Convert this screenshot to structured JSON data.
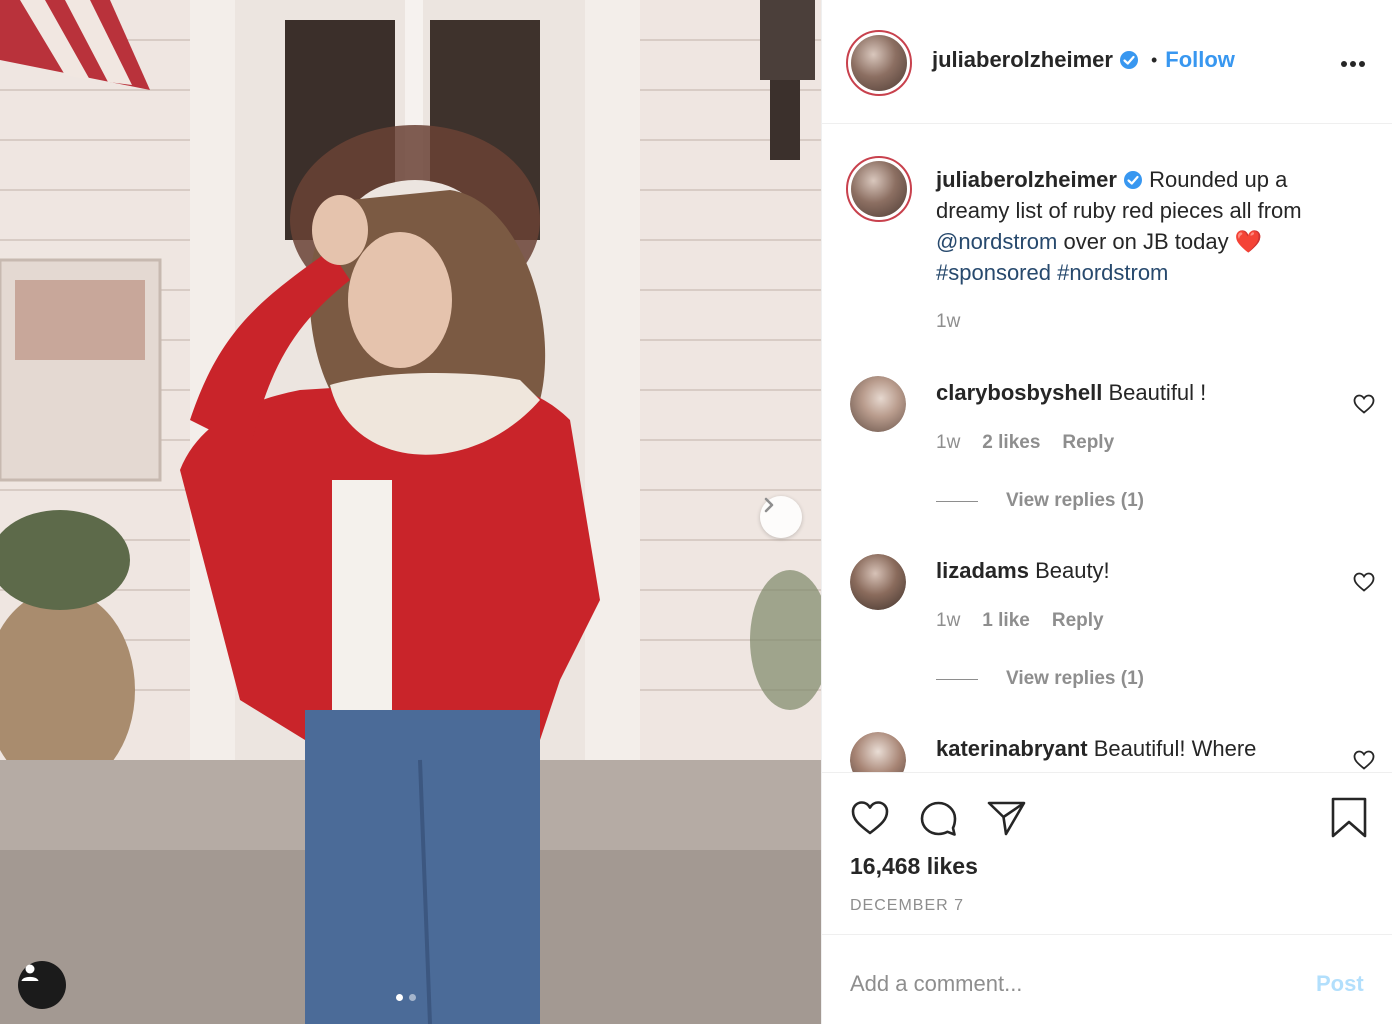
{
  "post": {
    "author": "juliaberolzheimer",
    "follow_label": "Follow",
    "separator": "•",
    "more_icon": "more-horizontal-icon"
  },
  "caption": {
    "username": "juliaberolzheimer",
    "text_1": "Rounded up a dreamy list of ruby red pieces all from",
    "mention": "@nordstrom",
    "text_2": "over on JB today",
    "emoji": "❤️",
    "hashtag_1": "#sponsored",
    "hashtag_2": "#nordstrom",
    "time": "1w"
  },
  "comments": [
    {
      "username": "clarybosbyshell",
      "text": "Beautiful !",
      "time": "1w",
      "likes": "2 likes",
      "reply_label": "Reply",
      "view_replies": "View replies (1)"
    },
    {
      "username": "lizadams",
      "text": "Beauty!",
      "time": "1w",
      "likes": "1 like",
      "reply_label": "Reply",
      "view_replies": "View replies (1)"
    },
    {
      "username": "katerinabryant",
      "text": "Beautiful! Where"
    }
  ],
  "actions": {
    "likes": "16,468 likes",
    "date": "DECEMBER 7"
  },
  "compose": {
    "placeholder": "Add a comment...",
    "post_label": "Post"
  },
  "carousel": {
    "total": 2,
    "current": 1
  },
  "colors": {
    "accent": "#3897f0",
    "link": "#27496d",
    "muted": "#8e8e8e",
    "avatar_ring": "#c8414d",
    "post_disabled": "#b2dffc"
  }
}
